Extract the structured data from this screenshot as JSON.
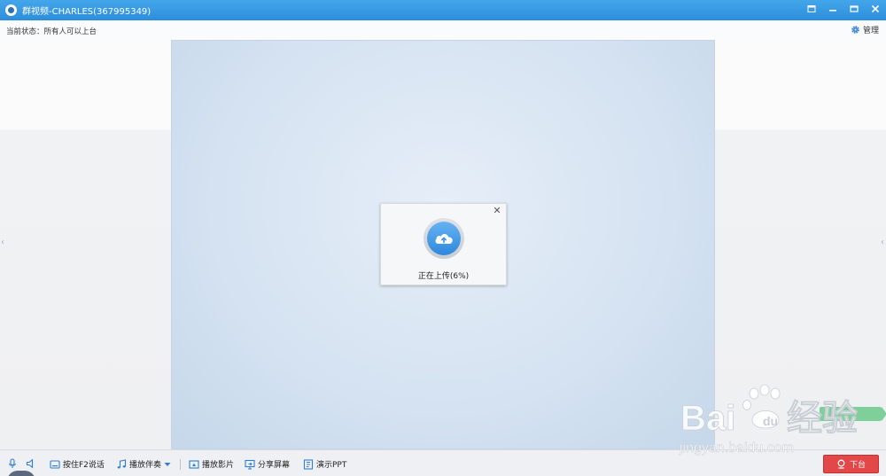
{
  "window": {
    "title": "群视频-CHARLES(367995349)"
  },
  "status": {
    "label": "当前状态：所有人可以上台",
    "manage_label": "管理"
  },
  "upload": {
    "text": "正在上传(6%)",
    "progress_percent": 6
  },
  "toolbar": {
    "push_to_talk": "按住F2说话",
    "play_accompaniment": "播放伴奏",
    "play_video": "播放影片",
    "share_screen": "分享屏幕",
    "present_ppt": "演示PPT",
    "leave_stage": "下台"
  },
  "watermark": {
    "brand": "Baidu经验",
    "url": "jingyan.baidu.com"
  },
  "colors": {
    "titlebar": "#3a9be6",
    "upload_icon": "#3d93e2",
    "leave_button": "#e24848"
  }
}
